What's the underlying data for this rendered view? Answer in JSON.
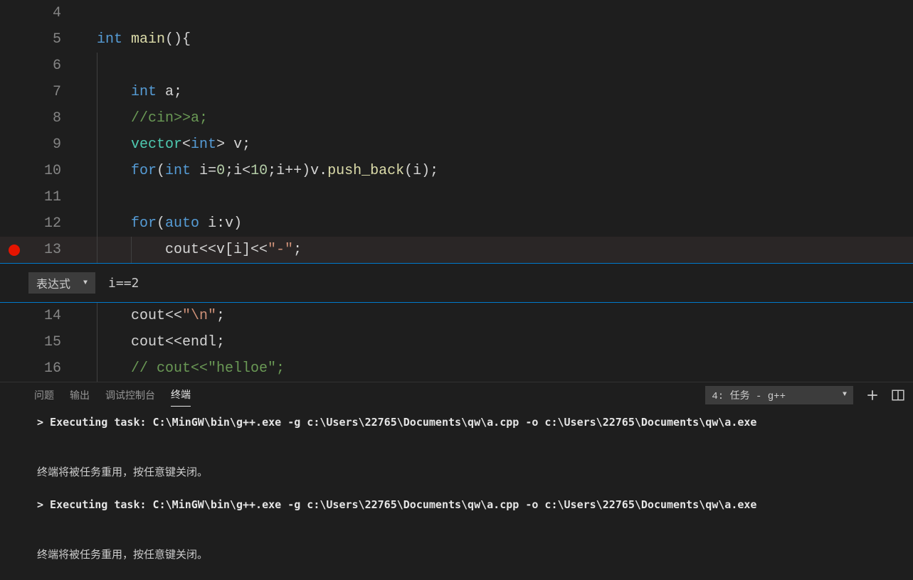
{
  "code1": [
    {
      "num": "4",
      "bp": false,
      "indent": 0,
      "tokens": []
    },
    {
      "num": "5",
      "bp": false,
      "indent": 0,
      "tokens": [
        {
          "c": "tok-kw",
          "t": "int"
        },
        {
          "c": "tok-plain",
          "t": " "
        },
        {
          "c": "tok-fn",
          "t": "main"
        },
        {
          "c": "tok-plain",
          "t": "(){"
        }
      ]
    },
    {
      "num": "6",
      "bp": false,
      "indent": 1,
      "tokens": []
    },
    {
      "num": "7",
      "bp": false,
      "indent": 1,
      "tokens": [
        {
          "c": "tok-plain",
          "t": "    "
        },
        {
          "c": "tok-kw",
          "t": "int"
        },
        {
          "c": "tok-plain",
          "t": " a;"
        }
      ]
    },
    {
      "num": "8",
      "bp": false,
      "indent": 1,
      "tokens": [
        {
          "c": "tok-plain",
          "t": "    "
        },
        {
          "c": "tok-comment",
          "t": "//cin>>a;"
        }
      ]
    },
    {
      "num": "9",
      "bp": false,
      "indent": 1,
      "tokens": [
        {
          "c": "tok-plain",
          "t": "    "
        },
        {
          "c": "tok-type",
          "t": "vector"
        },
        {
          "c": "tok-plain",
          "t": "<"
        },
        {
          "c": "tok-kw",
          "t": "int"
        },
        {
          "c": "tok-plain",
          "t": "> v;"
        }
      ]
    },
    {
      "num": "10",
      "bp": false,
      "indent": 1,
      "tokens": [
        {
          "c": "tok-plain",
          "t": "    "
        },
        {
          "c": "tok-kw",
          "t": "for"
        },
        {
          "c": "tok-plain",
          "t": "("
        },
        {
          "c": "tok-kw",
          "t": "int"
        },
        {
          "c": "tok-plain",
          "t": " i="
        },
        {
          "c": "tok-num",
          "t": "0"
        },
        {
          "c": "tok-plain",
          "t": ";i<"
        },
        {
          "c": "tok-num",
          "t": "10"
        },
        {
          "c": "tok-plain",
          "t": ";i++)v."
        },
        {
          "c": "tok-fn",
          "t": "push_back"
        },
        {
          "c": "tok-plain",
          "t": "(i);"
        }
      ]
    },
    {
      "num": "11",
      "bp": false,
      "indent": 1,
      "tokens": []
    },
    {
      "num": "12",
      "bp": false,
      "indent": 1,
      "tokens": [
        {
          "c": "tok-plain",
          "t": "    "
        },
        {
          "c": "tok-kw",
          "t": "for"
        },
        {
          "c": "tok-plain",
          "t": "("
        },
        {
          "c": "tok-kw",
          "t": "auto"
        },
        {
          "c": "tok-plain",
          "t": " i:v)"
        }
      ]
    },
    {
      "num": "13",
      "bp": true,
      "current": true,
      "indent": 2,
      "tokens": [
        {
          "c": "tok-plain",
          "t": "        cout<<v[i]<<"
        },
        {
          "c": "tok-str",
          "t": "\"-\""
        },
        {
          "c": "tok-plain",
          "t": ";"
        }
      ]
    }
  ],
  "conditional": {
    "dropdown_label": "表达式",
    "expression": "i==2"
  },
  "code2": [
    {
      "num": "14",
      "indent": 1,
      "tokens": [
        {
          "c": "tok-plain",
          "t": "    cout<<"
        },
        {
          "c": "tok-str",
          "t": "\"\\n\""
        },
        {
          "c": "tok-plain",
          "t": ";"
        }
      ]
    },
    {
      "num": "15",
      "indent": 1,
      "tokens": [
        {
          "c": "tok-plain",
          "t": "    cout<<endl;"
        }
      ]
    },
    {
      "num": "16",
      "indent": 1,
      "tokens": [
        {
          "c": "tok-plain",
          "t": "    "
        },
        {
          "c": "tok-comment",
          "t": "// cout<<\"helloe\";"
        }
      ]
    }
  ],
  "panel": {
    "tabs": [
      "问题",
      "输出",
      "调试控制台",
      "终端"
    ],
    "active_tab": 3,
    "terminal_selector": "4: 任务 - g++",
    "lines": [
      {
        "bold": true,
        "t": "> Executing task: C:\\MinGW\\bin\\g++.exe -g c:\\Users\\22765\\Documents\\qw\\a.cpp -o c:\\Users\\22765\\Documents\\qw\\a.exe"
      },
      {
        "bold": false,
        "t": ""
      },
      {
        "bold": false,
        "t": ""
      },
      {
        "bold": false,
        "t": "终端将被任务重用，按任意键关闭。"
      },
      {
        "bold": false,
        "t": ""
      },
      {
        "bold": true,
        "t": "> Executing task: C:\\MinGW\\bin\\g++.exe -g c:\\Users\\22765\\Documents\\qw\\a.cpp -o c:\\Users\\22765\\Documents\\qw\\a.exe"
      },
      {
        "bold": false,
        "t": ""
      },
      {
        "bold": false,
        "t": ""
      },
      {
        "bold": false,
        "t": "终端将被任务重用，按任意键关闭。"
      }
    ]
  }
}
